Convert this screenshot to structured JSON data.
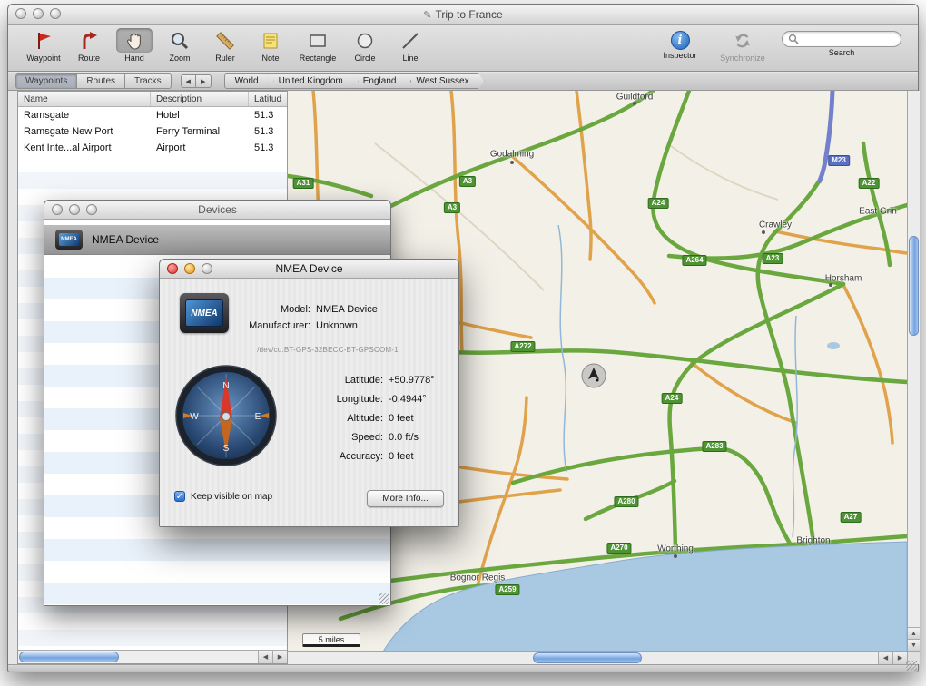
{
  "colors": {
    "selection_blue": "#3b78dd",
    "road_green": "#4e9434",
    "road_orange": "#e0a24b",
    "motorway_blue": "#6a79c8",
    "water": "#a9c9e2"
  },
  "window": {
    "title": "Trip to France"
  },
  "toolbar": {
    "tools": [
      {
        "label": "Waypoint"
      },
      {
        "label": "Route"
      },
      {
        "label": "Hand"
      },
      {
        "label": "Zoom"
      },
      {
        "label": "Ruler"
      },
      {
        "label": "Note"
      },
      {
        "label": "Rectangle"
      },
      {
        "label": "Circle"
      },
      {
        "label": "Line"
      }
    ],
    "inspector_label": "Inspector",
    "synchronize_label": "Synchronize",
    "search_label": "Search",
    "search_value": ""
  },
  "nav": {
    "tabs": [
      {
        "label": "Waypoints"
      },
      {
        "label": "Routes"
      },
      {
        "label": "Tracks"
      }
    ],
    "breadcrumb": [
      {
        "label": "World"
      },
      {
        "label": "United Kingdom"
      },
      {
        "label": "England"
      },
      {
        "label": "West Sussex"
      }
    ]
  },
  "panel": {
    "columns": [
      {
        "label": "Name"
      },
      {
        "label": "Description"
      },
      {
        "label": "Latitud"
      }
    ],
    "rows": [
      {
        "name": "Ramsgate",
        "description": "Hotel",
        "latitude": "51.3"
      },
      {
        "name": "Ramsgate New Port",
        "description": "Ferry Terminal",
        "latitude": "51.3"
      },
      {
        "name": "Kent Inte...al Airport",
        "description": "Airport",
        "latitude": "51.3"
      }
    ]
  },
  "map": {
    "scale": "5 miles",
    "towns": [
      {
        "name": "Guildford"
      },
      {
        "name": "Godalming"
      },
      {
        "name": "Crawley"
      },
      {
        "name": "Horsham"
      },
      {
        "name": "East Grin"
      },
      {
        "name": "Worthing"
      },
      {
        "name": "Brighton"
      },
      {
        "name": "Bognor Regis"
      }
    ],
    "badges": [
      {
        "label": "A31"
      },
      {
        "label": "A3"
      },
      {
        "label": "A3"
      },
      {
        "label": "A24"
      },
      {
        "label": "M23"
      },
      {
        "label": "A22"
      },
      {
        "label": "A264"
      },
      {
        "label": "A23"
      },
      {
        "label": "A272"
      },
      {
        "label": "A24"
      },
      {
        "label": "A283"
      },
      {
        "label": "A280"
      },
      {
        "label": "A27"
      },
      {
        "label": "A270"
      },
      {
        "label": "A259"
      }
    ]
  },
  "devices_window": {
    "title": "Devices",
    "items": [
      {
        "label": "NMEA Device"
      }
    ]
  },
  "nmea_window": {
    "title": "NMEA Device",
    "icon_text": "NMEA",
    "info": [
      {
        "label": "Model:",
        "value": "NMEA Device"
      },
      {
        "label": "Manufacturer:",
        "value": "Unknown"
      }
    ],
    "port": "/dev/cu.BT-GPS-32BECC-BT-GPSCOM-1",
    "compass": {
      "n": "N",
      "e": "E",
      "s": "S",
      "w": "W"
    },
    "stats": [
      {
        "label": "Latitude:",
        "value": "+50.9778°"
      },
      {
        "label": "Longitude:",
        "value": "-0.4944°"
      },
      {
        "label": "Altitude:",
        "value": "0 feet"
      },
      {
        "label": "Speed:",
        "value": "0.0 ft/s"
      },
      {
        "label": "Accuracy:",
        "value": "0 feet"
      }
    ],
    "checkbox_label": "Keep visible on map",
    "checkbox_checked": true,
    "more_info_label": "More Info..."
  }
}
